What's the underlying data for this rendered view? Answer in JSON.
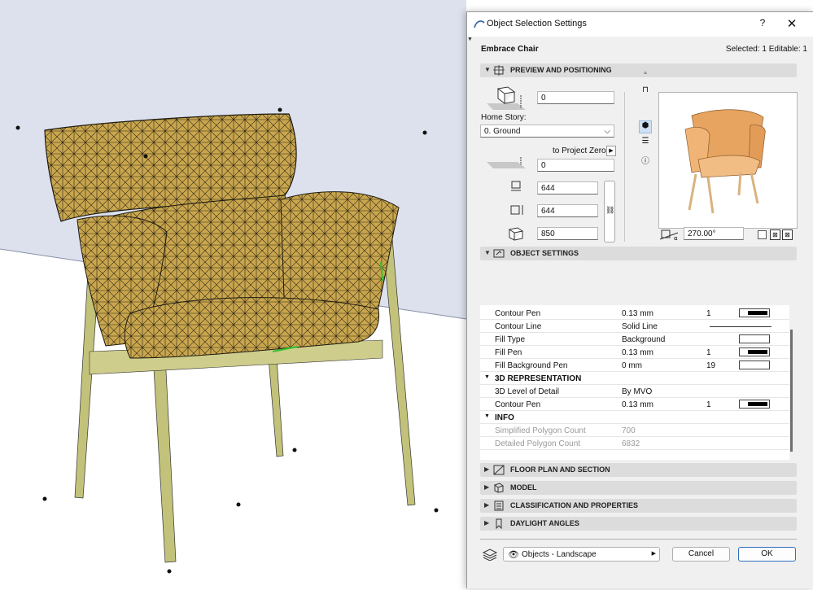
{
  "dialog": {
    "title": "Object Selection Settings",
    "help_label": "?",
    "close_label": "✕",
    "object_name": "Embrace Chair",
    "selection_info": "Selected: 1 Editable: 1"
  },
  "preview_section": {
    "label": "PREVIEW AND POSITIONING",
    "elevation_value": "0",
    "home_story_label": "Home Story:",
    "home_story_value": "0. Ground",
    "project_zero_label": "to Project Zero",
    "project_zero_value": "0",
    "width_value": "644",
    "depth_value": "644",
    "height_value": "850",
    "rotation_value": "270.00°"
  },
  "object_settings": {
    "label": "OBJECT SETTINGS",
    "rows": [
      {
        "name": "Contour Pen",
        "value": "0.13 mm",
        "num": "1",
        "swatch": "pen"
      },
      {
        "name": "Contour Line",
        "value": "Solid Line",
        "num": "",
        "swatch": "line"
      },
      {
        "name": "Fill Type",
        "value": "Background",
        "num": "",
        "swatch": "empty"
      },
      {
        "name": "Fill Pen",
        "value": "0.13 mm",
        "num": "1",
        "swatch": "pen"
      },
      {
        "name": "Fill Background Pen",
        "value": "0 mm",
        "num": "19",
        "swatch": "empty"
      }
    ],
    "group_3d": "3D REPRESENTATION",
    "rows_3d": [
      {
        "name": "3D Level of Detail",
        "value": "By MVO",
        "num": "",
        "swatch": ""
      },
      {
        "name": "Contour Pen",
        "value": "0.13 mm",
        "num": "1",
        "swatch": "pen"
      }
    ],
    "group_info": "INFO",
    "rows_info": [
      {
        "name": "Simplified Polygon Count",
        "value": "700"
      },
      {
        "name": "Detailed Polygon Count",
        "value": "6832"
      }
    ]
  },
  "collapsed_sections": [
    {
      "label": "FLOOR PLAN AND SECTION"
    },
    {
      "label": "MODEL"
    },
    {
      "label": "CLASSIFICATION AND PROPERTIES"
    },
    {
      "label": "DAYLIGHT ANGLES"
    }
  ],
  "footer": {
    "layer_value": "Objects - Landscape",
    "cancel_label": "Cancel",
    "ok_label": "OK"
  },
  "colors": {
    "mesh_fill": "#c9a64e",
    "leg_fill": "#c2c27a",
    "floor_back": "#dde1ee",
    "accent": "#2f6fbf"
  }
}
